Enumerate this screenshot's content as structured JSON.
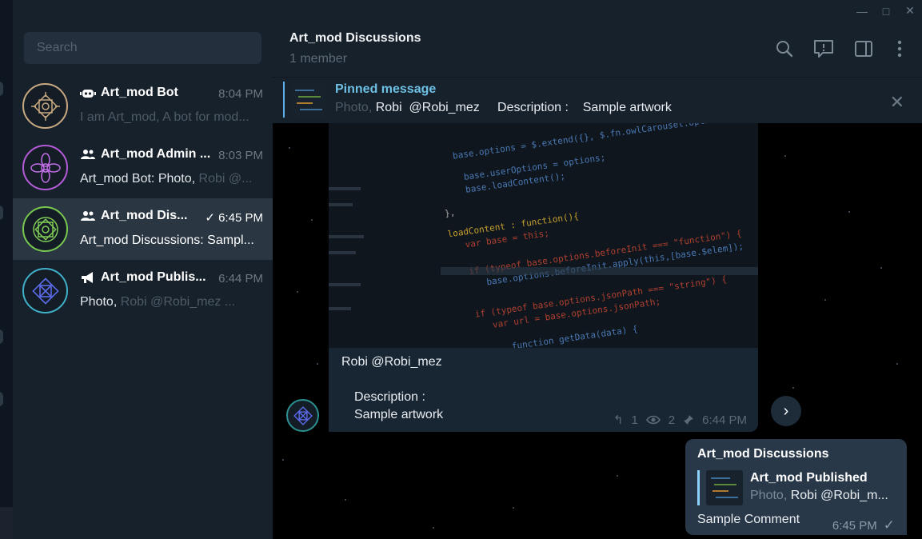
{
  "window": {
    "minimize": "—",
    "maximize": "□",
    "close": "✕"
  },
  "sidebar": {
    "search_placeholder": "Search",
    "dialogs": [
      {
        "type": "bot",
        "title": "Art_mod Bot",
        "time": "8:04 PM",
        "preview": "I am Art_mod, A bot for mod...",
        "accent": "#c8a880",
        "active": false
      },
      {
        "type": "group",
        "title": "Art_mod Admin ...",
        "time": "8:03 PM",
        "preview_sender": "Art_mod Bot:",
        "preview_text": "Photo,",
        "preview_dim": "Robi  @...",
        "accent": "#b45cd8",
        "active": false
      },
      {
        "type": "group",
        "title": "Art_mod Dis...",
        "time": "6:45 PM",
        "check": "✓",
        "preview": "Art_mod Discussions: Sampl...",
        "accent": "#78c850",
        "active": true
      },
      {
        "type": "channel",
        "title": "Art_mod Publis...",
        "time": "6:44 PM",
        "preview_text": "Photo,",
        "preview_dim": "Robi  @Robi_mez     ...",
        "accent": "#5a6ae8",
        "active": false
      }
    ]
  },
  "header": {
    "title": "Art_mod Discussions",
    "subtitle": "1 member"
  },
  "pinned": {
    "label": "Pinned message",
    "prefix": "Photo,",
    "text": "Robi  @Robi_mez     Description :    Sample artwork"
  },
  "message": {
    "author": "Robi  @Robi_mez",
    "desc_label": "Description :",
    "desc_value": "Sample artwork",
    "replies": "1",
    "views": "2",
    "time": "6:44 PM"
  },
  "reply": {
    "title": "Art_mod Discussions",
    "quoted_title": "Art_mod Published",
    "quoted_prefix": "Photo,",
    "quoted_text": "Robi  @Robi_m...",
    "comment": "Sample Comment",
    "time": "6:45 PM",
    "check": "✓"
  },
  "colors": {
    "sidebar_bg": "#17212b",
    "active_dialog": "#2a3642",
    "accent_blue": "#6ec1e4",
    "outgoing_bubble": "#283848"
  }
}
